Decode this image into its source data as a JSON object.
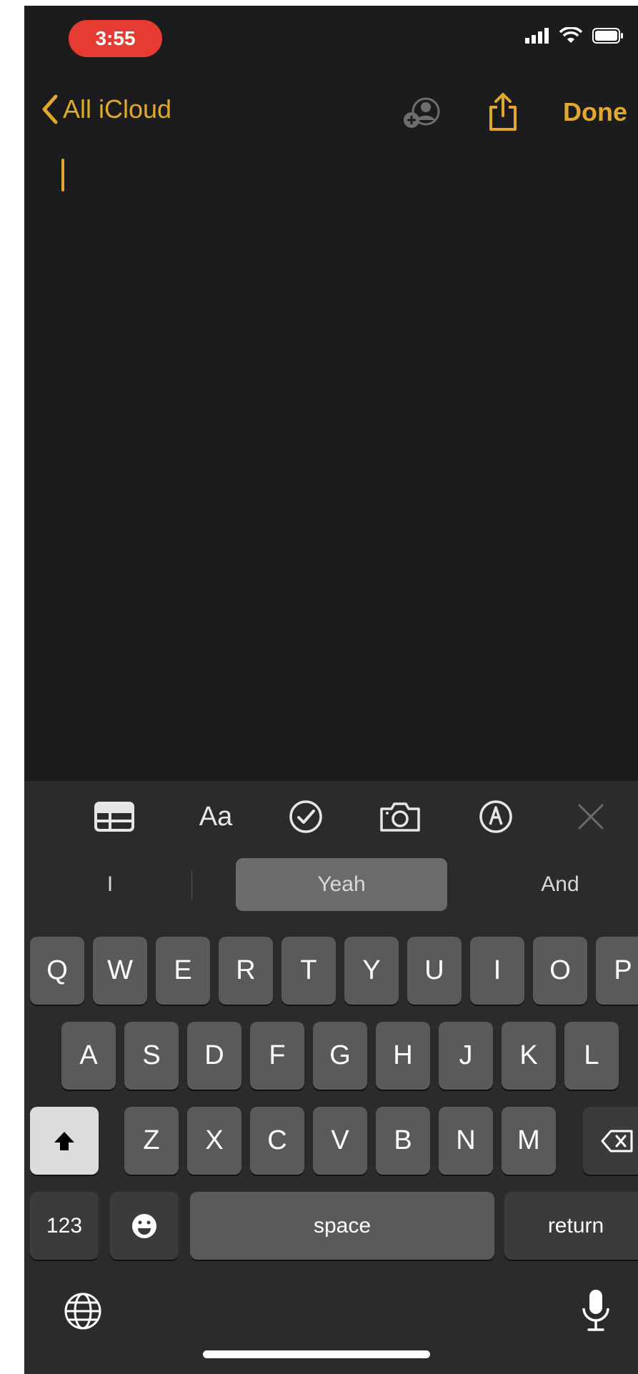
{
  "status_bar": {
    "time": "3:55"
  },
  "nav": {
    "back_label": "All iCloud",
    "done_label": "Done"
  },
  "format_bar": {
    "icons": [
      "table-icon",
      "format-text-icon",
      "checklist-icon",
      "camera-icon",
      "markup-icon",
      "close-icon"
    ],
    "format_label": "Aa"
  },
  "suggestions": [
    "I",
    "Yeah",
    "And"
  ],
  "keyboard": {
    "row1": [
      "Q",
      "W",
      "E",
      "R",
      "T",
      "Y",
      "U",
      "I",
      "O",
      "P"
    ],
    "row2": [
      "A",
      "S",
      "D",
      "F",
      "G",
      "H",
      "J",
      "K",
      "L"
    ],
    "row3": [
      "Z",
      "X",
      "C",
      "V",
      "B",
      "N",
      "M"
    ],
    "numbers_label": "123",
    "space_label": "space",
    "return_label": "return"
  },
  "colors": {
    "accent": "#e0a92b",
    "background": "#1c1c1e",
    "keyboard": "#2b2b2d",
    "status_pill": "#e63b32"
  }
}
